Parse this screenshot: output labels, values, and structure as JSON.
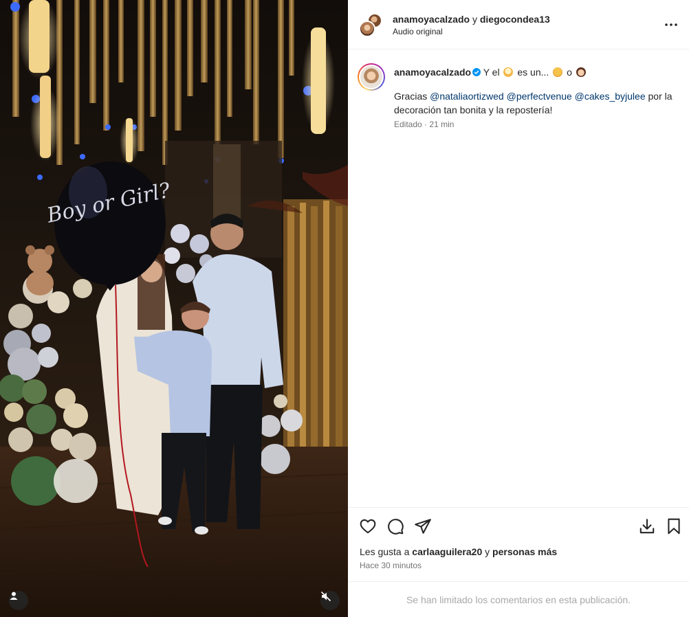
{
  "post": {
    "media": {
      "balloon_text": "Boy or Girl?",
      "user_tag_icon": "user-tag-icon",
      "mute_icon": "muted-speaker-icon"
    },
    "header": {
      "author_1": "anamoyacalzado",
      "joiner": "y",
      "author_2": "diegocondea13",
      "audio_label": "Audio original",
      "more_icon": "more-options-icon"
    },
    "caption": {
      "username": "anamoyacalzado",
      "verified": true,
      "text_1": "Y el",
      "text_2": "es un...",
      "text_3": "o",
      "body_prefix": "Gracias",
      "mentions": [
        "@nataliaortizwed",
        "@perfectvenue",
        "@cakes_byjulee"
      ],
      "body_suffix": "por la decoración tan bonita y la repostería!",
      "edited_label": "Editado",
      "separator": "·",
      "age": "21 min"
    },
    "actions": {
      "icons": [
        "heart-icon",
        "comment-icon",
        "share-icon",
        "download-icon",
        "bookmark-icon"
      ],
      "likes_prefix": "Les gusta a",
      "likes_user": "carlaaguilera20",
      "likes_joiner": "y",
      "likes_others": "personas más",
      "timestamp": "Hace 30 minutos"
    },
    "comments_limited": "Se han limitado los comentarios en esta publicación.",
    "colors": {
      "mention": "#00376b",
      "secondary_text": "#737373",
      "verified_badge": "#0095f6",
      "divider": "#efefef"
    }
  }
}
